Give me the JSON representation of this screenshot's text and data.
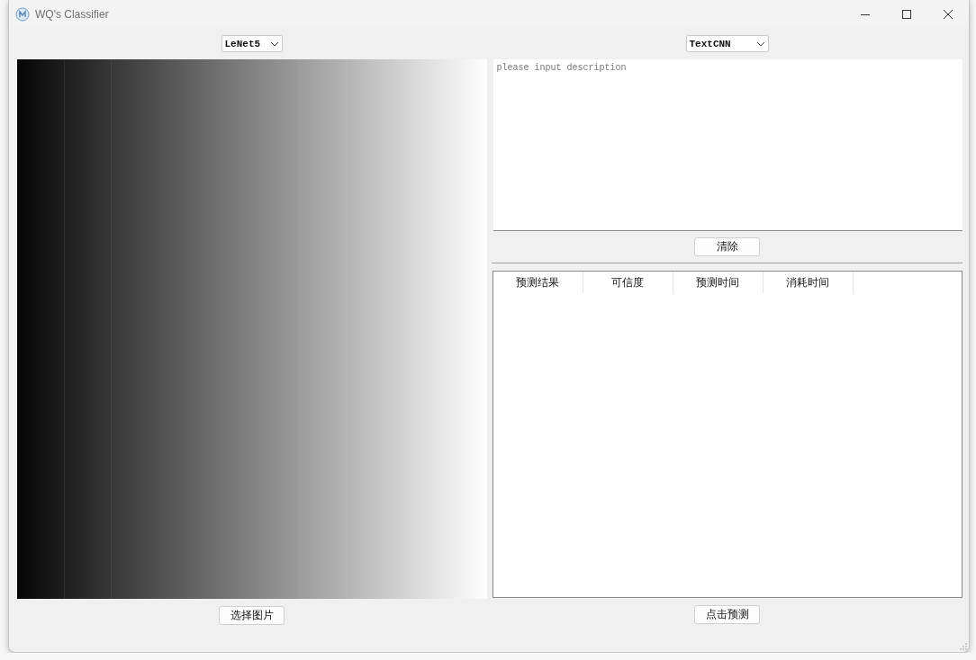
{
  "window": {
    "title": "WQ's Classifier"
  },
  "image_panel": {
    "model_select": {
      "value": "LeNet5"
    },
    "button": "选择图片"
  },
  "text_panel": {
    "model_select": {
      "value": "TextCNN"
    },
    "description": {
      "placeholder": "please input description"
    },
    "clear_button": "清除",
    "table": {
      "columns": [
        "预测结果",
        "可信度",
        "预测时间",
        "消耗时间"
      ]
    },
    "predict_button": "点击预测"
  }
}
